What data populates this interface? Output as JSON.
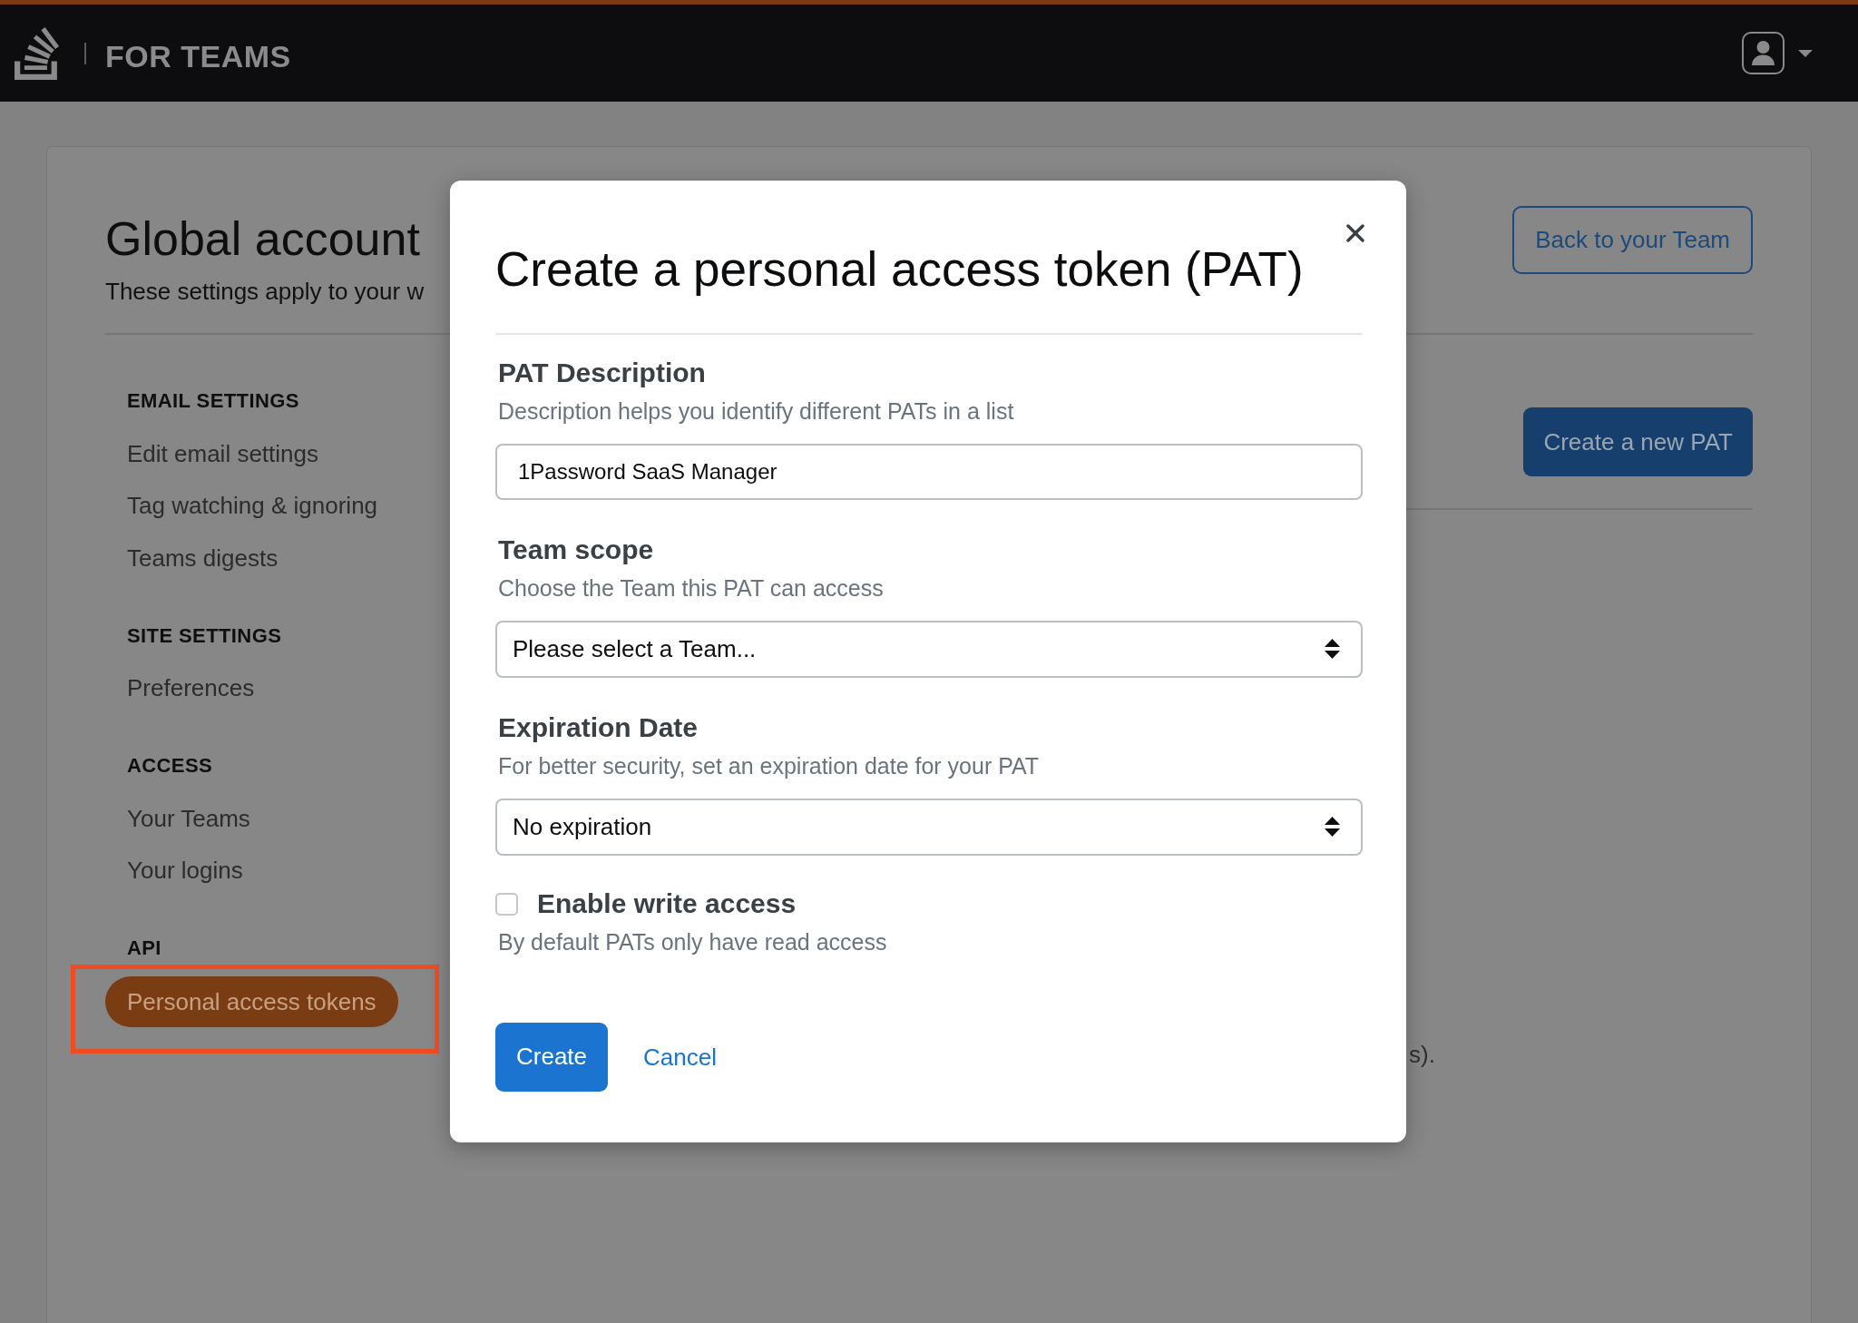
{
  "top_bar": {
    "brand": "FOR TEAMS"
  },
  "page": {
    "title": "Global account",
    "subtitle": "These settings apply to your w",
    "back_button": "Back to your Team"
  },
  "sidebar": {
    "groups": [
      {
        "heading": "EMAIL SETTINGS",
        "items": [
          {
            "label": "Edit email settings",
            "selected": false,
            "highlighted": false
          },
          {
            "label": "Tag watching & ignoring",
            "selected": false,
            "highlighted": false
          },
          {
            "label": "Teams digests",
            "selected": false,
            "highlighted": false
          }
        ]
      },
      {
        "heading": "SITE SETTINGS",
        "items": [
          {
            "label": "Preferences",
            "selected": false,
            "highlighted": false
          }
        ]
      },
      {
        "heading": "ACCESS",
        "items": [
          {
            "label": "Your Teams",
            "selected": false,
            "highlighted": false
          },
          {
            "label": "Your logins",
            "selected": false,
            "highlighted": false
          }
        ]
      },
      {
        "heading": "API",
        "items": [
          {
            "label": "Personal access tokens",
            "selected": true,
            "highlighted": true
          }
        ]
      }
    ]
  },
  "main": {
    "new_button": "Create a new PAT",
    "text_fragment": "s)."
  },
  "dialog": {
    "title": "Create a personal access token (PAT)",
    "fields": [
      {
        "kind": "text",
        "label": "PAT Description",
        "help": "Description helps you identify different PATs in a list",
        "value": "1Password SaaS Manager"
      },
      {
        "kind": "select",
        "label": "Team scope",
        "help": "Choose the Team this PAT can access",
        "value": "Please select a Team..."
      },
      {
        "kind": "select",
        "label": "Expiration Date",
        "help": "For better security, set an expiration date for your PAT",
        "value": "No expiration"
      }
    ],
    "checkbox": {
      "label": "Enable write access",
      "checked": false,
      "help": "By default PATs only have read access"
    },
    "buttons": [
      {
        "kind": "primary",
        "label": "Create"
      },
      {
        "kind": "link",
        "label": "Cancel"
      }
    ]
  }
}
